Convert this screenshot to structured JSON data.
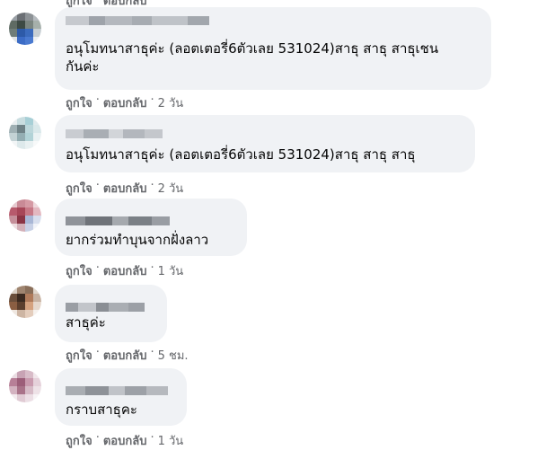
{
  "labels": {
    "like": "ถูกใจ",
    "reply": "ตอบกลับ",
    "sep": "·"
  },
  "comments": [
    {
      "text": "อนุโมทนาสาธุค่ะ (ลอตเตอรี่6ตัวเลย 531024)สาธุ สาธุ สาธุเชน\nกันค่ะ",
      "time": "2 วัน"
    },
    {
      "text": "อนุโมทนาสาธุค่ะ (ลอตเตอรี่6ตัวเลย 531024)สาธุ สาธุ สาธุ",
      "time": "2 วัน"
    },
    {
      "text": "ยากร่วมทำบุนจากฝั่งลาว",
      "time": "1 วัน"
    },
    {
      "text": "สาธุค่ะ",
      "time": "5 ชม."
    },
    {
      "text": "กราบสาธุคะ",
      "time": "1 วัน"
    }
  ],
  "colors": {
    "bubble": "#f0f2f5",
    "meta": "#65676b",
    "text": "#050505"
  }
}
